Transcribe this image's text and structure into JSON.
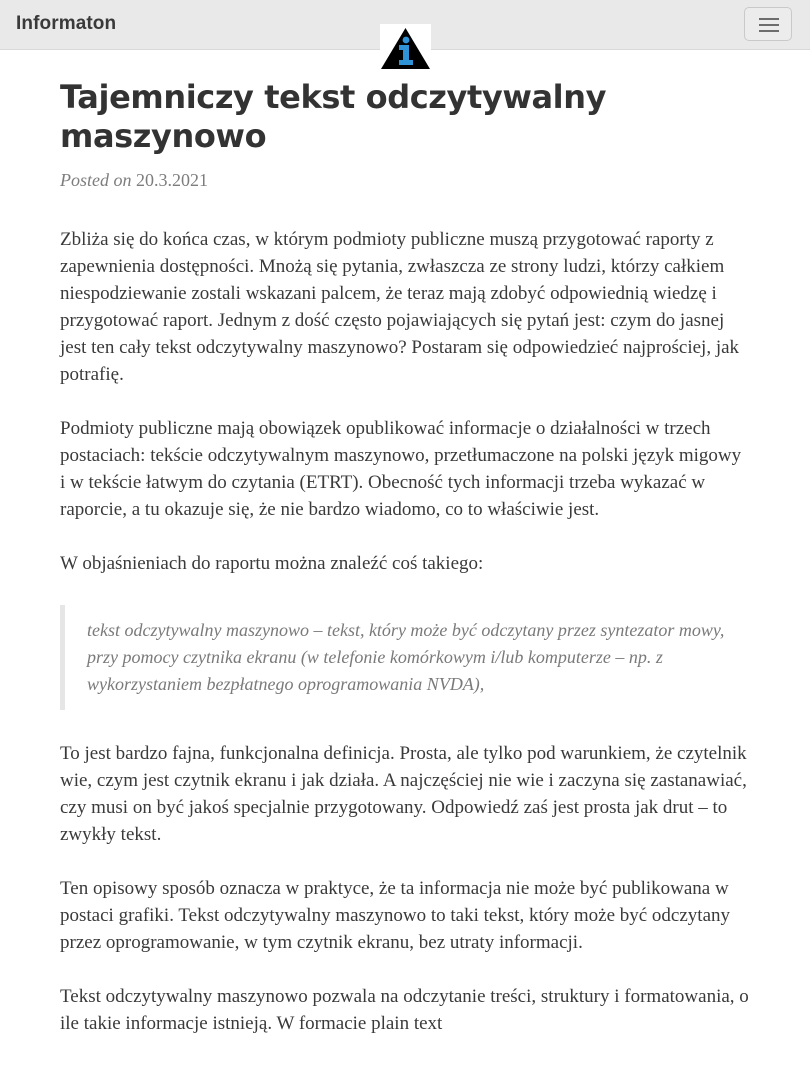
{
  "header": {
    "brand": "Informaton",
    "logo_icon": "info-i-triangle-logo",
    "menu_icon": "hamburger-menu-icon"
  },
  "article": {
    "title": "Tajemniczy tekst odczytywalny maszynowo",
    "posted_label": "Posted on",
    "date": "20.3.2021",
    "paragraphs": [
      "Zbliża się do końca czas, w którym podmioty publiczne muszą przygotować raporty z zapewnienia dostępności. Mnożą się pytania, zwłaszcza ze strony ludzi, którzy całkiem niespodziewanie zostali wskazani palcem, że teraz mają zdobyć odpowiednią wiedzę i przygotować raport. Jednym z dość często pojawiających się pytań jest: czym do jasnej jest ten cały tekst odczytywalny maszynowo? Postaram się odpowiedzieć najprościej, jak potrafię.",
      "Podmioty publiczne mają obowiązek opublikować informacje o działalności w trzech postaciach: tekście odczytywalnym maszynowo, przetłumaczone na polski język migowy i w tekście łatwym do czytania (ETRT). Obecność tych informacji trzeba wykazać w raporcie, a tu okazuje się, że nie bardzo wiadomo, co to właściwie jest.",
      "W objaśnieniach do raportu można znaleźć coś takiego:",
      "To jest bardzo fajna, funkcjonalna definicja. Prosta, ale tylko pod warunkiem, że czytelnik wie, czym jest czytnik ekranu i jak działa. A najczęściej nie wie i zaczyna się zastanawiać, czy musi on być jakoś specjalnie przygotowany. Odpowiedź zaś jest prosta jak drut – to zwykły tekst.",
      "Ten opisowy sposób oznacza w praktyce, że ta informacja nie może być publikowana w postaci grafiki. Tekst odczytywalny maszynowo to taki tekst, który może być odczytany przez oprogramowanie, w tym czytnik ekranu, bez utraty informacji.",
      "Tekst odczytywalny maszynowo pozwala na odczytanie treści, struktury i formatowania, o ile takie informacje istnieją. W formacie plain text"
    ],
    "quote": "tekst odczytywalny maszynowo – tekst, który może być odczytany przez syntezator mowy, przy pomocy czytnika ekranu (w telefonie komórkowym i/lub komputerze – np. z wykorzystaniem bezpłatnego oprogramowania NVDA),"
  }
}
